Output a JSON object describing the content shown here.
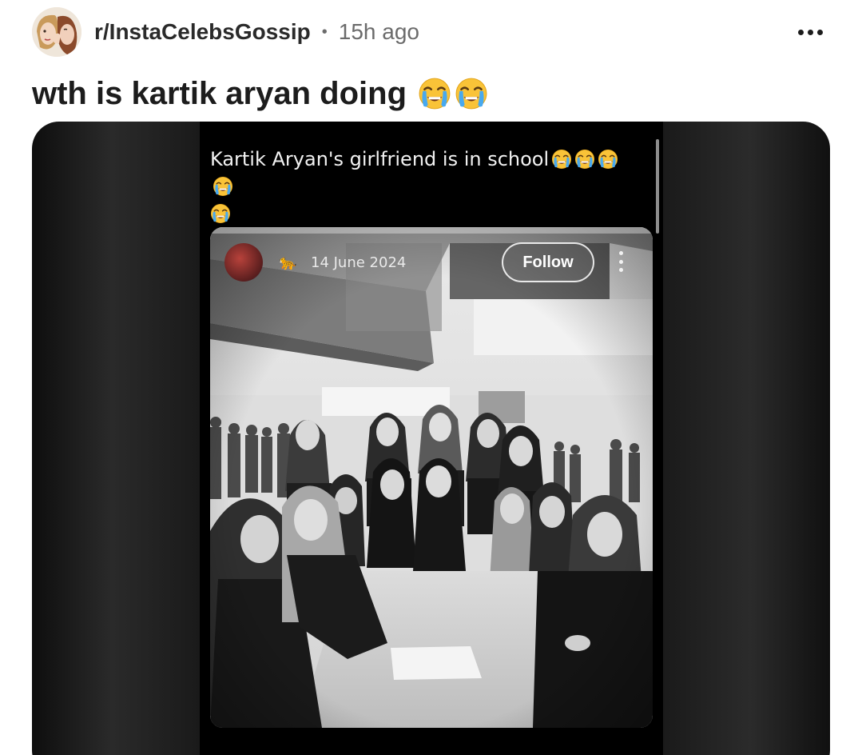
{
  "post": {
    "subreddit": "r/InstaCelebsGossip",
    "separator": "•",
    "time": "15h ago",
    "more_icon": "more-horizontal-icon",
    "title": "wth is kartik aryan doing",
    "title_emojis": [
      "loudly-crying-face",
      "loudly-crying-face"
    ]
  },
  "media": {
    "caption": "Kartik Aryan's girlfriend is in school",
    "caption_emojis": [
      "loudly-crying-face",
      "loudly-crying-face",
      "loudly-crying-face",
      "loudly-crying-face",
      "loudly-crying-face"
    ],
    "embedded_post": {
      "date": "14 June 2024",
      "follow_label": "Follow",
      "badge_icon": "leopard-icon",
      "menu_icon": "more-vertical-icon"
    }
  }
}
